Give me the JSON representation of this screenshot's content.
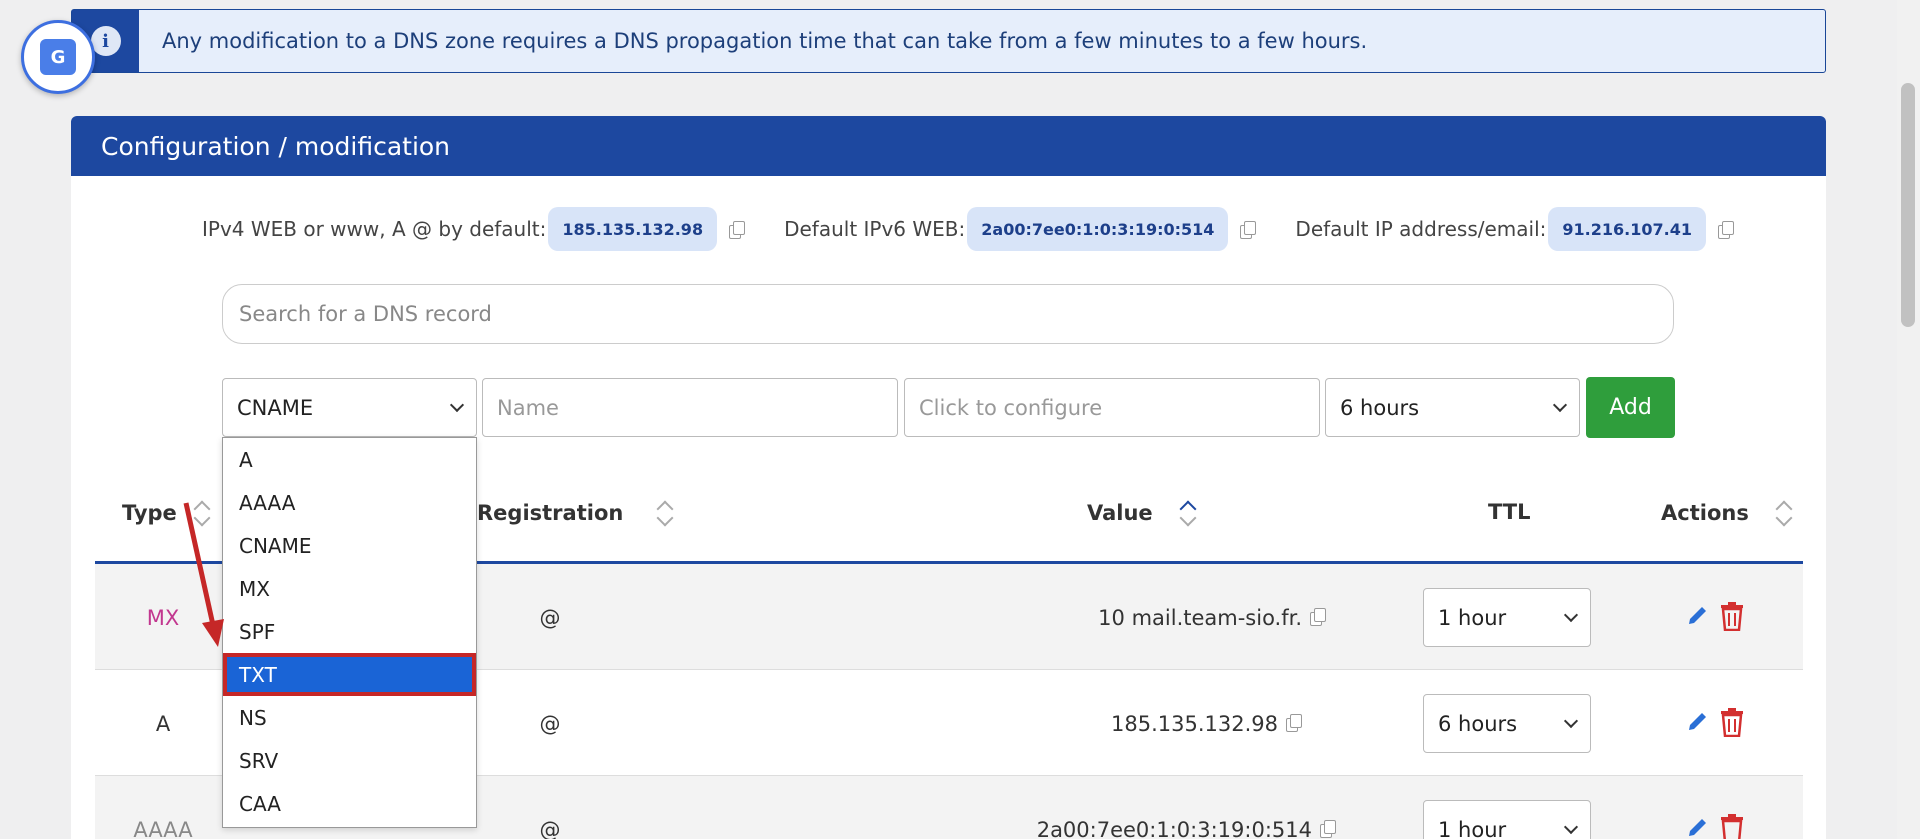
{
  "banner": {
    "icon": "info-icon",
    "text": "Any modification to a DNS zone requires a DNS propagation time that can take from a few minutes to a few hours."
  },
  "translate_badge": {
    "icon": "google-translate-icon"
  },
  "card": {
    "title": "Configuration / modification",
    "ip": {
      "ipv4_label": "IPv4 WEB or www, A @ by default:",
      "ipv4_value": "185.135.132.98",
      "ipv6_label": "Default IPv6 WEB:",
      "ipv6_value": "2a00:7ee0:1:0:3:19:0:514",
      "email_label": "Default IP address/email:",
      "email_value": "91.216.107.41"
    },
    "search_placeholder": "Search for a DNS record",
    "form": {
      "type_selected": "CNAME",
      "name_placeholder": "Name",
      "value_placeholder": "Click to configure",
      "ttl_selected": "6 hours",
      "add_label": "Add"
    },
    "type_options": [
      "A",
      "AAAA",
      "CNAME",
      "MX",
      "SPF",
      "TXT",
      "NS",
      "SRV",
      "CAA"
    ],
    "highlighted_option": "TXT",
    "table": {
      "headers": {
        "type": "Type",
        "registration": "Registration",
        "value": "Value",
        "ttl": "TTL",
        "actions": "Actions"
      },
      "rows": [
        {
          "type": "MX",
          "registration": "@",
          "value": "10 mail.team-sio.fr.",
          "ttl": "1 hour"
        },
        {
          "type": "A",
          "registration": "@",
          "value": "185.135.132.98",
          "ttl": "6 hours"
        },
        {
          "type": "AAAA",
          "registration": "@",
          "value": "2a00:7ee0:1:0:3:19:0:514",
          "ttl": "1 hour"
        }
      ]
    }
  },
  "colors": {
    "primary": "#1d48a0",
    "add": "#2f9e3c",
    "mx_type": "#c2378f",
    "delete": "#d32f2f",
    "edit": "#2a6fd6",
    "annotation_arrow": "#c52727"
  }
}
